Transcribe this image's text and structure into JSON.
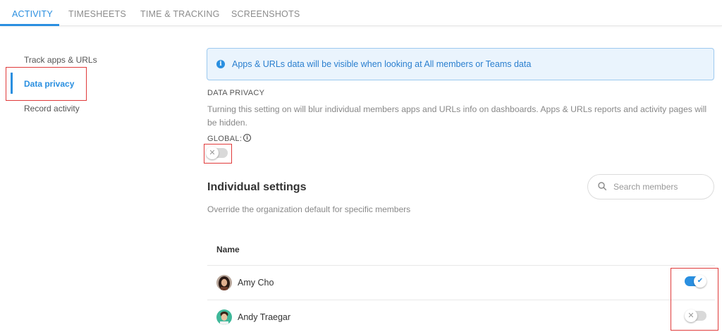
{
  "tabs": [
    {
      "label": "ACTIVITY",
      "active": true
    },
    {
      "label": "TIMESHEETS",
      "active": false
    },
    {
      "label": "TIME & TRACKING",
      "active": false
    },
    {
      "label": "SCREENSHOTS",
      "active": false
    }
  ],
  "sidebar": {
    "items": [
      {
        "label": "Track apps & URLs",
        "active": false
      },
      {
        "label": "Data privacy",
        "active": true
      },
      {
        "label": "Record activity",
        "active": false
      }
    ]
  },
  "banner": {
    "icon": "info-icon",
    "text": "Apps & URLs data will be visible when looking at All members or Teams data"
  },
  "privacy": {
    "title": "DATA PRIVACY",
    "description": "Turning this setting on will blur individual members apps and URLs info on dashboards. Apps & URLs reports and activity pages will be hidden.",
    "global_label": "GLOBAL:",
    "global_enabled": false
  },
  "individual": {
    "title": "Individual settings",
    "subtitle": "Override the organization default for specific members",
    "search_placeholder": "Search members",
    "column_name": "Name",
    "members": [
      {
        "name": "Amy Cho",
        "enabled": true
      },
      {
        "name": "Andy Traegar",
        "enabled": false
      }
    ]
  },
  "colors": {
    "accent": "#2a8fe0",
    "highlight_box": "#e03a3a",
    "toggle_off": "#d9d9d9"
  }
}
